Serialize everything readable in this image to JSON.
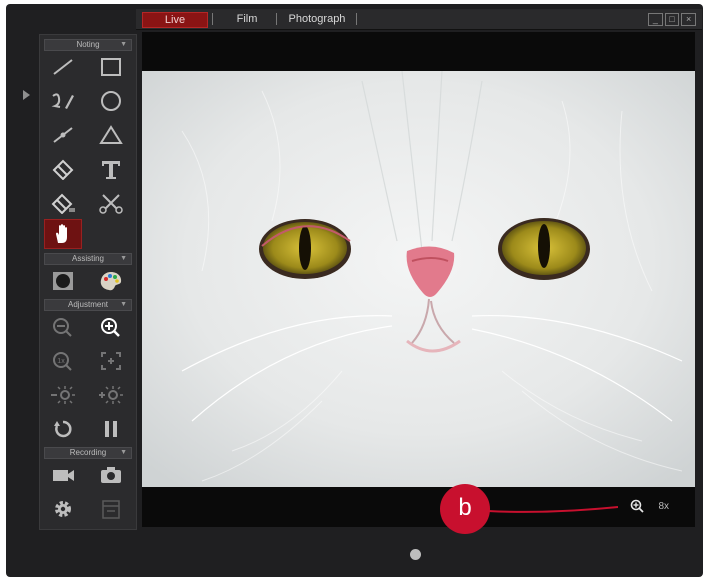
{
  "tabs": {
    "live": "Live",
    "film": "Film",
    "photograph": "Photograph"
  },
  "window_controls": {
    "minimize": "_",
    "maximize": "□",
    "close": "×"
  },
  "sections": {
    "noting": "Noting",
    "assisting": "Assisting",
    "adjustment": "Adjustment",
    "recording": "Recording"
  },
  "zoom": {
    "level": "8x"
  },
  "callout": {
    "label": "b"
  },
  "colors": {
    "accent": "#8a1414",
    "callout": "#c8102e",
    "panel": "#2b2b2d"
  },
  "icons": [
    "line-icon",
    "rectangle-icon",
    "freehand-icon",
    "circle-icon",
    "measure-icon",
    "triangle-icon",
    "eraser-icon",
    "text-icon",
    "eraser-all-icon",
    "scissors-icon",
    "hand-icon",
    "contrast-icon",
    "palette-icon",
    "zoom-out-icon",
    "zoom-in-icon",
    "zoom-1x-icon",
    "fit-icon",
    "brightness-down-icon",
    "brightness-up-icon",
    "rotate-icon",
    "pause-icon",
    "video-camera-icon",
    "camera-icon",
    "settings-icon",
    "storage-icon",
    "zoom-indicator-icon"
  ]
}
